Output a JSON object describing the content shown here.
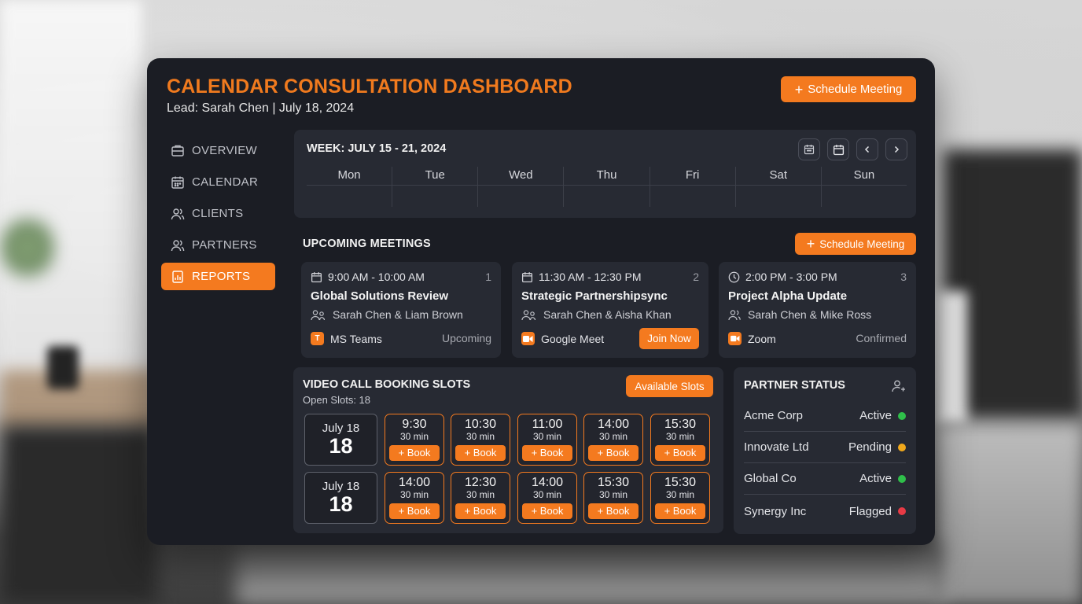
{
  "header": {
    "title": "CALENDAR CONSULTATION DASHBOARD",
    "subtitle": "Lead: Sarah Chen | July 18, 2024",
    "schedule_label": "Schedule Meeting"
  },
  "sidebar": {
    "items": [
      {
        "label": "OVERVIEW",
        "icon": "overview-icon",
        "active": false
      },
      {
        "label": "CALENDAR",
        "icon": "calendar-icon",
        "active": false
      },
      {
        "label": "CLIENTS",
        "icon": "users-icon",
        "active": false
      },
      {
        "label": "PARTNERS",
        "icon": "users-icon",
        "active": false
      },
      {
        "label": "REPORTS",
        "icon": "report-icon",
        "active": true
      }
    ]
  },
  "week": {
    "title": "WEEK: JULY 15 - 21, 2024",
    "days": [
      "Mon",
      "Tue",
      "Wed",
      "Thu",
      "Fri",
      "Sat",
      "Sun"
    ]
  },
  "upcoming": {
    "title": "UPCOMING MEETINGS",
    "schedule_label": "Schedule Meeting",
    "meetings": [
      {
        "time": "9:00 AM - 10:00 AM",
        "index": "1",
        "name": "Global Solutions Review",
        "people": "Sarah Chen & Liam Brown",
        "platform": "MS Teams",
        "status": "Upcoming",
        "icon": "clock-icon"
      },
      {
        "time": "11:30 AM - 12:30 PM",
        "index": "2",
        "name": "Strategic Partnershipsync",
        "people": "Sarah Chen & Aisha Khan",
        "platform": "Google Meet",
        "action": "Join Now",
        "icon": "calendar-icon"
      },
      {
        "time": "2:00 PM - 3:00 PM",
        "index": "3",
        "name": "Project Alpha Update",
        "people": "Sarah Chen & Mike Ross",
        "platform": "Zoom",
        "status": "Confirmed",
        "icon": "clock-icon"
      }
    ]
  },
  "booking": {
    "title": "VIDEO CALL BOOKING SLOTS",
    "open_slots": "Open Slots: 18",
    "available_label": "Available Slots",
    "rows": [
      {
        "date_label": "July 18",
        "date_num": "18",
        "slots": [
          {
            "time": "9:30",
            "duration": "30 min",
            "book": "+ Book"
          },
          {
            "time": "10:30",
            "duration": "30 min",
            "book": "+ Book"
          },
          {
            "time": "11:00",
            "duration": "30 min",
            "book": "+ Book"
          },
          {
            "time": "14:00",
            "duration": "30 min",
            "book": "+ Book"
          },
          {
            "time": "15:30",
            "duration": "30 min",
            "book": "+ Book"
          }
        ]
      },
      {
        "date_label": "July 18",
        "date_num": "18",
        "slots": [
          {
            "time": "14:00",
            "duration": "30 min",
            "book": "+ Book"
          },
          {
            "time": "12:30",
            "duration": "30 min",
            "book": "+ Book"
          },
          {
            "time": "14:00",
            "duration": "30 min",
            "book": "+ Book"
          },
          {
            "time": "15:30",
            "duration": "30 min",
            "book": "+ Book"
          },
          {
            "time": "15:30",
            "duration": "30 min",
            "book": "+ Book"
          }
        ]
      }
    ]
  },
  "partners": {
    "title": "PARTNER STATUS",
    "rows": [
      {
        "name": "Acme Corp",
        "status": "Active",
        "color": "#2fbf4a"
      },
      {
        "name": "Innovate Ltd",
        "status": "Pending",
        "color": "#f0a81c"
      },
      {
        "name": "Global Co",
        "status": "Active",
        "color": "#2fbf4a"
      },
      {
        "name": "Synergy Inc",
        "status": "Flagged",
        "color": "#e83a45"
      }
    ]
  },
  "colors": {
    "accent": "#f47a1f",
    "panel": "#1b1d24",
    "card": "#272a33"
  }
}
